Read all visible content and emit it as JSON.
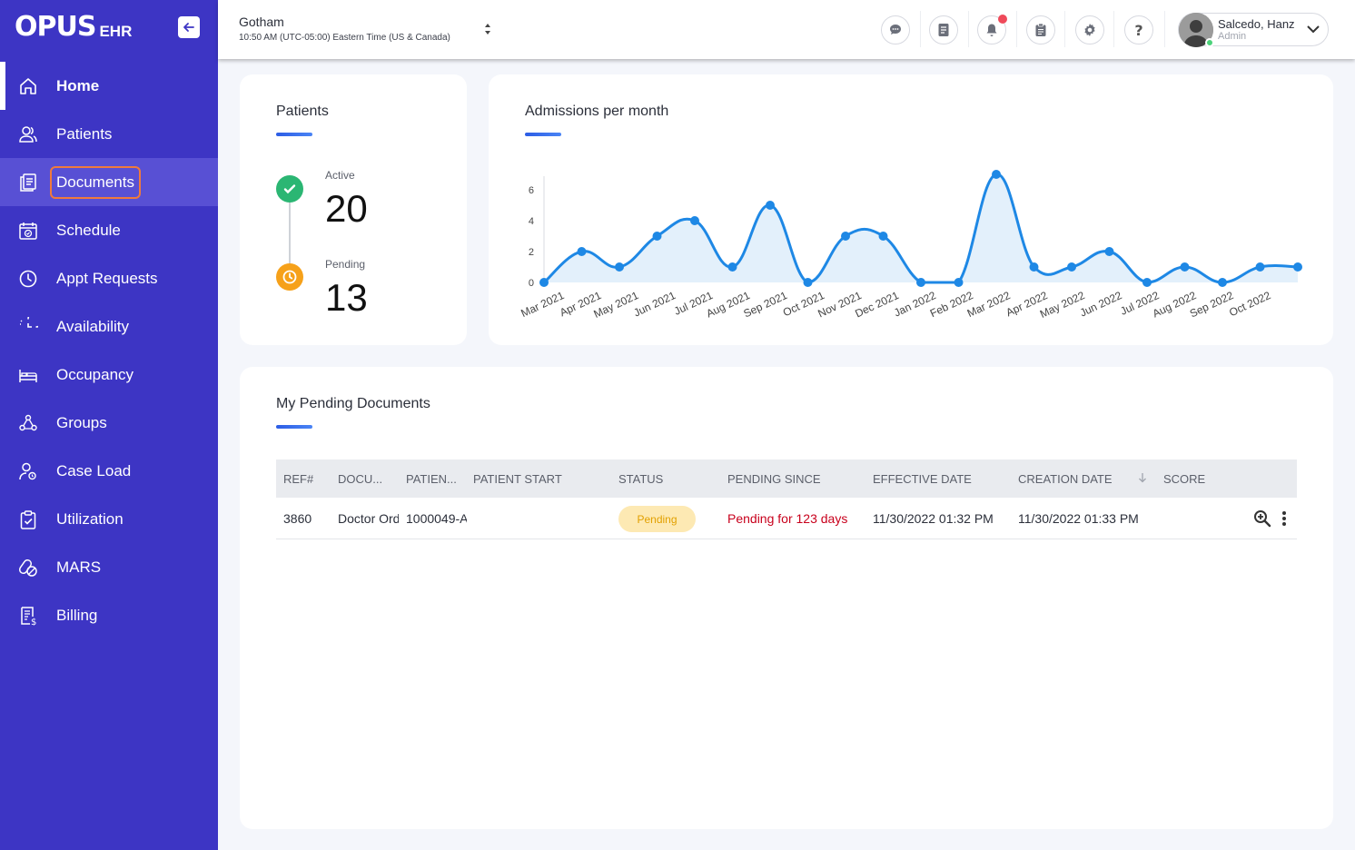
{
  "app": {
    "logo_text": "OPUS",
    "logo_suffix": "EHR"
  },
  "sidebar": {
    "items": [
      {
        "label": "Home",
        "icon": "home-icon"
      },
      {
        "label": "Patients",
        "icon": "users-icon"
      },
      {
        "label": "Documents",
        "icon": "documents-icon"
      },
      {
        "label": "Schedule",
        "icon": "calendar-icon"
      },
      {
        "label": "Appt Requests",
        "icon": "clock-icon"
      },
      {
        "label": "Availability",
        "icon": "availability-icon"
      },
      {
        "label": "Occupancy",
        "icon": "bed-icon"
      },
      {
        "label": "Groups",
        "icon": "groups-icon"
      },
      {
        "label": "Case Load",
        "icon": "case-load-icon"
      },
      {
        "label": "Utilization",
        "icon": "clipboard-check-icon"
      },
      {
        "label": "MARS",
        "icon": "pills-icon"
      },
      {
        "label": "Billing",
        "icon": "billing-icon"
      }
    ]
  },
  "header": {
    "location": "Gotham",
    "timezone": "10:50 AM (UTC-05:00) Eastern Time (US & Canada)",
    "user_name": "Salcedo, Hanz",
    "user_role": "Admin",
    "icons": [
      "chat-icon",
      "notes-icon",
      "bell-icon",
      "clipboard-icon",
      "gear-icon",
      "help-icon"
    ]
  },
  "patients_card": {
    "title": "Patients",
    "active_label": "Active",
    "active_value": "20",
    "pending_label": "Pending",
    "pending_value": "13"
  },
  "chart_data": {
    "type": "area",
    "title": "Admissions per month",
    "categories": [
      "Mar 2021",
      "Apr 2021",
      "May 2021",
      "Jun 2021",
      "Jul 2021",
      "Aug 2021",
      "Sep 2021",
      "Oct 2021",
      "Nov 2021",
      "Dec 2021",
      "Jan 2022",
      "Feb 2022",
      "Mar 2022",
      "Apr 2022",
      "May 2022",
      "Jun 2022",
      "Jul 2022",
      "Aug 2022",
      "Sep 2022",
      "Oct 2022"
    ],
    "values": [
      0,
      2,
      1,
      3,
      4,
      1,
      5,
      0,
      3,
      3,
      0,
      0,
      7,
      1,
      1,
      2,
      0,
      1,
      0,
      1,
      1
    ],
    "yticks": [
      0,
      2,
      4,
      6
    ],
    "ylim": [
      0,
      7
    ],
    "grid": false,
    "color": "#1e88e5"
  },
  "pending_docs": {
    "title": "My Pending Documents",
    "columns": [
      "REF#",
      "DOCU...",
      "PATIEN...",
      "PATIENT START",
      "STATUS",
      "PENDING SINCE",
      "EFFECTIVE DATE",
      "CREATION DATE",
      "SCORE"
    ],
    "rows": [
      {
        "ref": "3860",
        "document": "Doctor Orders",
        "patient": "1000049-A",
        "patient_start": "",
        "status": "Pending",
        "pending_since": "Pending for 123 days",
        "effective_date": "11/30/2022 01:32 PM",
        "creation_date": "11/30/2022 01:33 PM",
        "score": ""
      }
    ]
  }
}
